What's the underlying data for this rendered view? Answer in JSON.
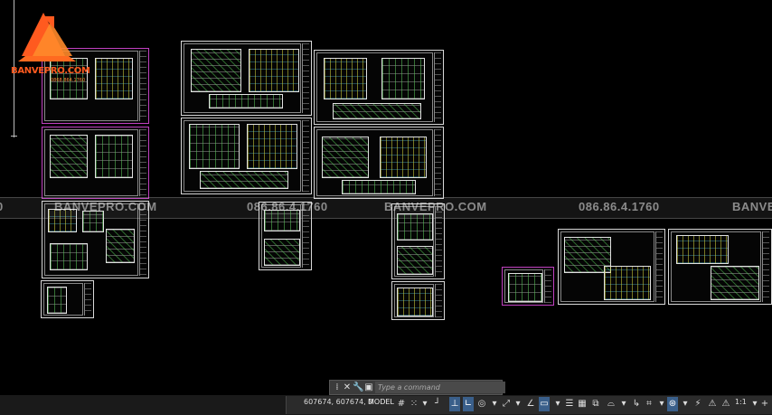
{
  "watermark": {
    "texts": [
      {
        "text": "0"
      },
      {
        "text": "BANVEPRO.COM"
      },
      {
        "text": "086.86.4.1760"
      },
      {
        "text": "BANVEPRO.COM"
      },
      {
        "text": "086.86.4.1760"
      },
      {
        "text": "BANVE"
      }
    ]
  },
  "logo": {
    "brand": "BANVEPRO.COM",
    "sub": "0868.864.1760"
  },
  "command_line": {
    "placeholder": "Type a command"
  },
  "status_bar": {
    "coordinates": "607674, 607674, 0",
    "model_label": "MODEL",
    "scale": "1:1",
    "icons": [
      "grid-icon",
      "snap-icon",
      "snap-dropdown-icon",
      "ortho-icon",
      "polar-icon",
      "polar-dropdown-icon",
      "isodraft-icon",
      "isodraft-dropdown-icon",
      "object-snap-tracking-icon",
      "object-snap-icon",
      "object-snap-dropdown-icon",
      "lineweight-icon",
      "transparency-icon",
      "selection-cycling-icon",
      "3d-osnap-icon",
      "3d-osnap-dropdown-icon",
      "dynamic-ucs-icon",
      "selection-filter-icon",
      "selection-filter-dropdown-icon",
      "gizmo-icon",
      "annotation-visibility-icon",
      "annotation-visibility-dropdown-icon",
      "auto-scale-icon",
      "annotation-scale-icon",
      "annotation-scale-dropdown-icon"
    ]
  },
  "colors": {
    "canvas": "#000000",
    "accent_orange": "#ff5a1f",
    "status_active": "#3a5f8a"
  }
}
